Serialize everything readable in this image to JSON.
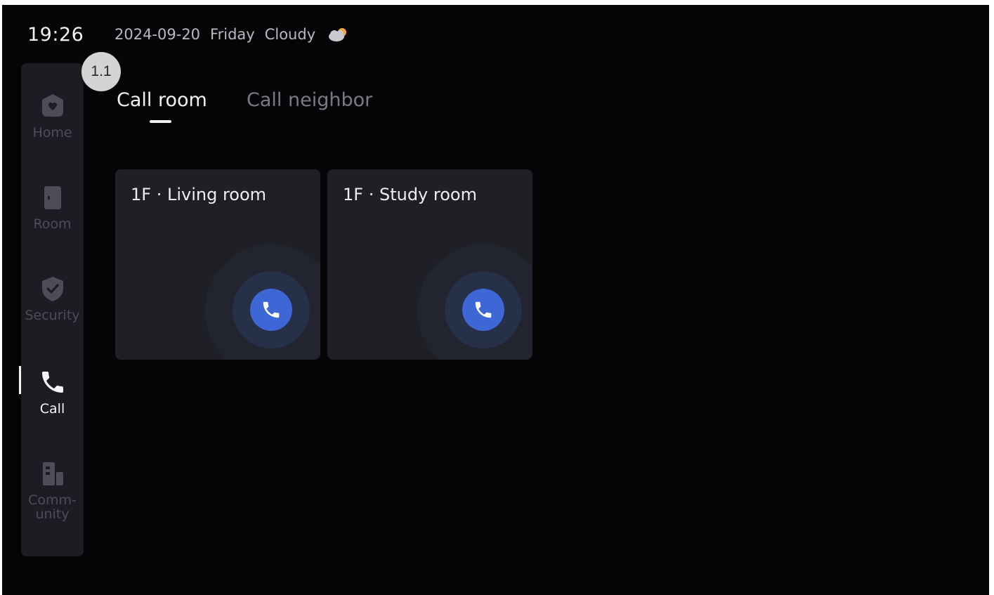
{
  "status_bar": {
    "time": "19:26",
    "date": "2024-09-20",
    "weekday": "Friday",
    "weather": "Cloudy",
    "weather_icon": "cloud-sun-icon"
  },
  "step_badge": "1.1",
  "sidebar": {
    "items": [
      {
        "label": "Home",
        "icon": "home-icon",
        "active": false
      },
      {
        "label": "Room",
        "icon": "door-icon",
        "active": false
      },
      {
        "label": "Security",
        "icon": "shield-check-icon",
        "active": false
      },
      {
        "label": "Call",
        "icon": "phone-icon",
        "active": true
      },
      {
        "label_line1": "Comm-",
        "label_line2": "unity",
        "icon": "buildings-icon",
        "active": false
      }
    ]
  },
  "tabs": [
    {
      "label": "Call room",
      "active": true
    },
    {
      "label": "Call neighbor",
      "active": false
    }
  ],
  "rooms": [
    {
      "title": "1F · Living room",
      "action_icon": "phone-icon"
    },
    {
      "title": "1F · Study room",
      "action_icon": "phone-icon"
    }
  ],
  "colors": {
    "background": "#050508",
    "sidebar": "#1c1d22",
    "card": "#1f2026",
    "accent_blue": "#3e67d6",
    "text_primary": "#f2f2f4",
    "text_inactive": "#4c4d55"
  }
}
